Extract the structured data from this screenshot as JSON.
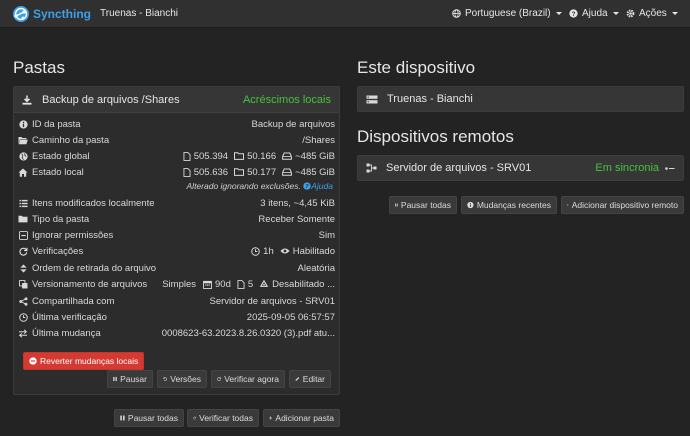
{
  "topbar": {
    "brand": "Syncthing",
    "device_name": "Truenas - Bianchi",
    "language": "Portuguese (Brazil)",
    "help": "Ajuda",
    "actions": "Ações"
  },
  "folders": {
    "heading": "Pastas",
    "folder": {
      "name": "Backup de arquivos /Shares",
      "status": "Acréscimos locais",
      "rows": {
        "id": {
          "label": "ID da pasta",
          "value": "Backup de arquivos"
        },
        "path": {
          "label": "Caminho da pasta",
          "value": "/Shares"
        },
        "global": {
          "label": "Estado global",
          "files": "505.394",
          "dirs": "50.166",
          "size": "~485 GiB"
        },
        "local": {
          "label": "Estado local",
          "files": "505.636",
          "dirs": "50.177",
          "size": "~485 GiB"
        },
        "note": {
          "text": "Alterado ignorando exclusões.",
          "link": "Ajuda"
        },
        "modified": {
          "label": "Itens modificados localmente",
          "value": "3 itens, ~4,45 KiB"
        },
        "type": {
          "label": "Tipo da pasta",
          "value": "Receber Somente"
        },
        "perms": {
          "label": "Ignorar permissões",
          "value": "Sim"
        },
        "rescan": {
          "label": "Verificações",
          "interval": "1h",
          "watch": "Habilitado"
        },
        "order": {
          "label": "Ordem de retirada do arquivo",
          "value": "Aleatória"
        },
        "versioning": {
          "label": "Versionamento de arquivos",
          "type": "Simples",
          "days": "90d",
          "keep": "5",
          "cleanup": "Desabilitado ..."
        },
        "shared": {
          "label": "Compartilhada com",
          "value": "Servidor de arquivos - SRV01"
        },
        "last_scan": {
          "label": "Última verificação",
          "value": "2025-09-05 06:57:57"
        },
        "last_change": {
          "label": "Última mudança",
          "value": "0008623-63.2023.8.26.0320 (3).pdf atu..."
        }
      },
      "revert_button": "Reverter mudanças locais",
      "buttons": {
        "pause": "Pausar",
        "versions": "Versões",
        "rescan": "Verificar agora",
        "edit": "Editar"
      }
    },
    "buttons": {
      "pause_all": "Pausar todas",
      "rescan_all": "Verificar todas",
      "add": "Adicionar pasta"
    }
  },
  "this_device": {
    "heading": "Este dispositivo",
    "name": "Truenas - Bianchi"
  },
  "remote": {
    "heading": "Dispositivos remotos",
    "device": {
      "name": "Servidor de arquivos - SRV01",
      "status": "Em sincronia"
    },
    "buttons": {
      "pause_all": "Pausar todas",
      "recent": "Mudanças recentes",
      "add": "Adicionar dispositivo remoto"
    }
  },
  "colors": {
    "accent": "#3da0e8",
    "ok": "#46c23c",
    "danger": "#d43a31"
  }
}
